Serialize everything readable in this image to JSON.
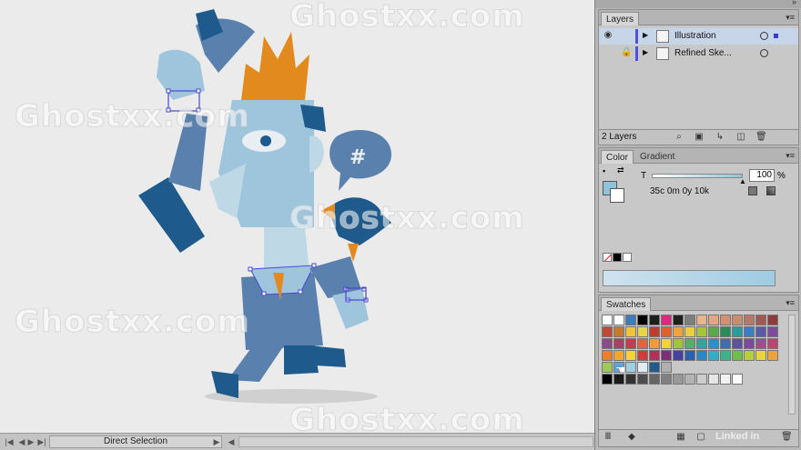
{
  "watermark": "Ghostxx.com",
  "colors": {
    "bg": "#ebebeb",
    "char_dark": "#1e5b8c",
    "char_mid": "#5a80ad",
    "char_light": "#9fc5dc",
    "char_pale": "#bfd8e6",
    "flame": "#e38a1f",
    "selection": "#4a46d6",
    "shadow": "#d0d0d0"
  },
  "layers_panel": {
    "tab": "Layers",
    "layers": [
      {
        "name": "Illustration",
        "selected": true,
        "color": "#4f4fe0"
      },
      {
        "name": "Refined Ske...",
        "selected": false,
        "color": "#4f4fe0"
      }
    ],
    "count": "2 Layers",
    "footer_icons": [
      "search-icon",
      "make-clipping-mask-icon",
      "new-sublayer-icon",
      "new-layer-icon",
      "trash-icon"
    ]
  },
  "color_panel": {
    "tabs": [
      "Color",
      "Gradient"
    ],
    "slider_label": "T",
    "tint_value": "100",
    "tint_unit": "%",
    "readout": "35c 0m 0y 10k",
    "fill_color": "#8fc3dd",
    "spectrum_start": "#cfe3ee",
    "spectrum_end": "#9fcbe2"
  },
  "swatches_panel": {
    "tab": "Swatches",
    "rows": [
      [
        "#ffffff",
        "#ffffff",
        "#3c7bbd",
        "#000000",
        "#1f1f1f",
        "#e3267d",
        "#202020",
        "#7d7d7d",
        "#e7b490",
        "#e7a583",
        "#d59072",
        "#c98e6e",
        "#b8776b",
        "#a45753",
        "#8e3c3c"
      ],
      [
        "#c04a3a",
        "#c77a2f",
        "#efc33a",
        "#e8d64a",
        "#c03d2e",
        "#e45f2a",
        "#f0a33a",
        "#ead13c",
        "#a8c43b",
        "#59a94b",
        "#2b8c5a",
        "#2b9c9e",
        "#3a7fc2",
        "#5c5aa8",
        "#7c4b9b"
      ],
      [
        "#8a4a8c",
        "#a5416c",
        "#c73c4d",
        "#e2643f",
        "#f09a3a",
        "#f1d33a",
        "#9ec63b",
        "#52b06b",
        "#2fa59c",
        "#2d8fc7",
        "#3b6db8",
        "#5a52a6",
        "#7e4aa1",
        "#a14a94",
        "#b84575"
      ],
      [
        "#f07d2a",
        "#f3a52c",
        "#f8d23a",
        "#d13b3b",
        "#b52f5b",
        "#7d2e7a",
        "#463ea0",
        "#2d5fb0",
        "#2b86c5",
        "#30b0c6",
        "#3bb38b",
        "#6dbf4a",
        "#b5cf3d",
        "#e9d63a",
        "#eea23a"
      ],
      [
        "#a3c85a",
        "#5fa6d8",
        "#9ecfe2",
        "#e0ecf2",
        "#1f5b8c",
        "#b0b0b0"
      ],
      [
        "#000000",
        "#1a1a1a",
        "#333333",
        "#4d4d4d",
        "#666666",
        "#808080",
        "#999999",
        "#b3b3b3",
        "#cccccc",
        "#e6e6e6",
        "#f2f2f2",
        "#ffffff"
      ]
    ]
  },
  "status_bar": {
    "tool": "Direct Selection"
  },
  "brand_mark": "Linked in"
}
